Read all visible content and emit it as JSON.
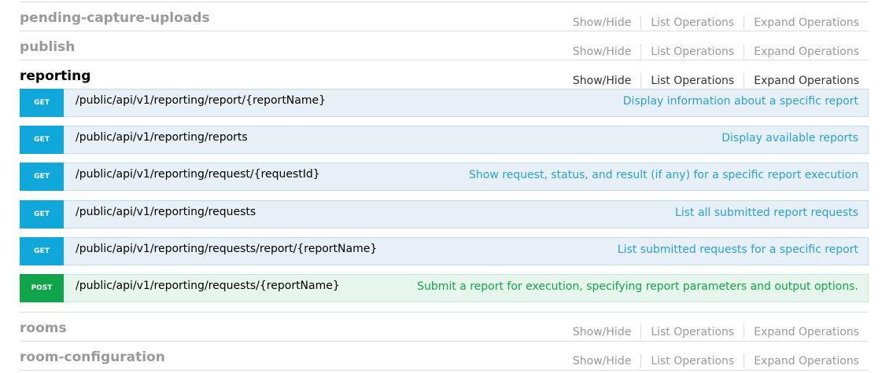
{
  "link_labels": {
    "show_hide": "Show/Hide",
    "list_operations": "List Operations",
    "expand_operations": "Expand Operations"
  },
  "resources": {
    "pending_capture_uploads": {
      "name": "pending-capture-uploads"
    },
    "publish": {
      "name": "publish"
    },
    "reporting": {
      "name": "reporting",
      "operations": [
        {
          "method": "GET",
          "path": "/public/api/v1/reporting/report/{reportName}",
          "summary": "Display information about a specific report"
        },
        {
          "method": "GET",
          "path": "/public/api/v1/reporting/reports",
          "summary": "Display available reports"
        },
        {
          "method": "GET",
          "path": "/public/api/v1/reporting/request/{requestId}",
          "summary": "Show request, status, and result (if any) for a specific report execution"
        },
        {
          "method": "GET",
          "path": "/public/api/v1/reporting/requests",
          "summary": "List all submitted report requests"
        },
        {
          "method": "GET",
          "path": "/public/api/v1/reporting/requests/report/{reportName}",
          "summary": "List submitted requests for a specific report"
        },
        {
          "method": "POST",
          "path": "/public/api/v1/reporting/requests/{reportName}",
          "summary": "Submit a report for execution, specifying report parameters and output options."
        }
      ]
    },
    "rooms": {
      "name": "rooms"
    },
    "room_configuration": {
      "name": "room-configuration"
    }
  },
  "colors": {
    "get_method": "#10a7db",
    "post_method": "#10a54a",
    "get_bg": "#e7f0f7",
    "post_bg": "#e7f6ec",
    "inactive_text": "#999999"
  }
}
